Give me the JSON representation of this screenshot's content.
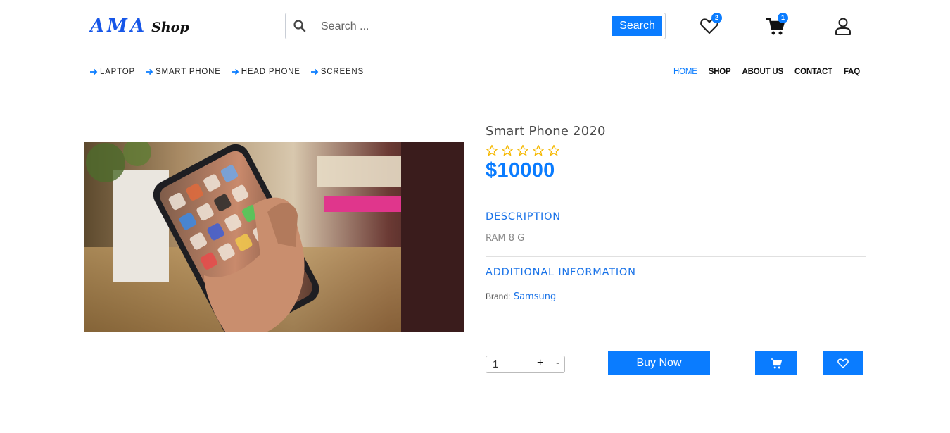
{
  "header": {
    "logo_main": "AMA",
    "logo_sub": "Shop",
    "search_placeholder": "Search ...",
    "search_button": "Search",
    "wishlist_count": "2",
    "cart_count": "1"
  },
  "categories": [
    {
      "label": "LAPTOP"
    },
    {
      "label": "SMART PHONE"
    },
    {
      "label": "HEAD PHONE"
    },
    {
      "label": "SCREENS"
    }
  ],
  "menu": [
    {
      "label": "HOME",
      "active": true
    },
    {
      "label": "SHOP"
    },
    {
      "label": "ABOUT US"
    },
    {
      "label": "CONTACT"
    },
    {
      "label": "FAQ"
    }
  ],
  "product": {
    "title": "Smart Phone 2020",
    "rating": 0,
    "rating_max": 5,
    "price": "$10000",
    "description_heading": "DESCRIPTION",
    "description": "RAM 8 G",
    "additional_heading": "ADDITIONAL INFORMATION",
    "brand_label": "Brand:",
    "brand_value": "Samsung",
    "image_icon": "smartphone-in-hand-photo"
  },
  "actions": {
    "quantity": "1",
    "plus": "+",
    "minus": "-",
    "buy_now": "Buy Now",
    "cart_icon": "cart-icon",
    "wishlist_icon": "heart-icon"
  },
  "colors": {
    "accent": "#0a7cff",
    "star": "#f5b800"
  }
}
